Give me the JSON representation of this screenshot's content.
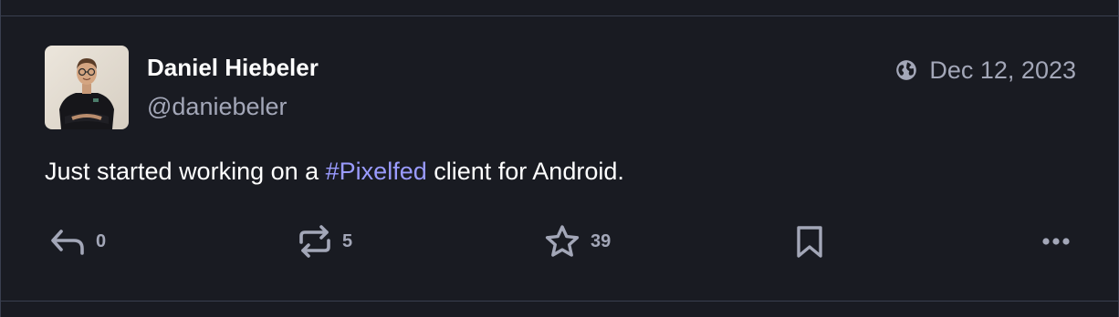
{
  "post": {
    "author": {
      "display_name": "Daniel Hiebeler",
      "handle": "@daniebeler"
    },
    "visibility_icon": "globe-icon",
    "date": "Dec 12, 2023",
    "content": {
      "before": "Just started working on a ",
      "hashtag": "#Pixelfed",
      "after": " client for Android."
    },
    "actions": {
      "reply": {
        "icon": "reply-icon",
        "count": "0"
      },
      "boost": {
        "icon": "boost-icon",
        "count": "5"
      },
      "favourite": {
        "icon": "star-icon",
        "count": "39"
      },
      "bookmark": {
        "icon": "bookmark-icon"
      },
      "more": {
        "icon": "more-icon"
      }
    }
  },
  "colors": {
    "background": "#191b22",
    "border": "#393f4f",
    "primary_text": "#ffffff",
    "secondary_text": "#a3a7b8",
    "hashtag": "#9a9bff"
  }
}
